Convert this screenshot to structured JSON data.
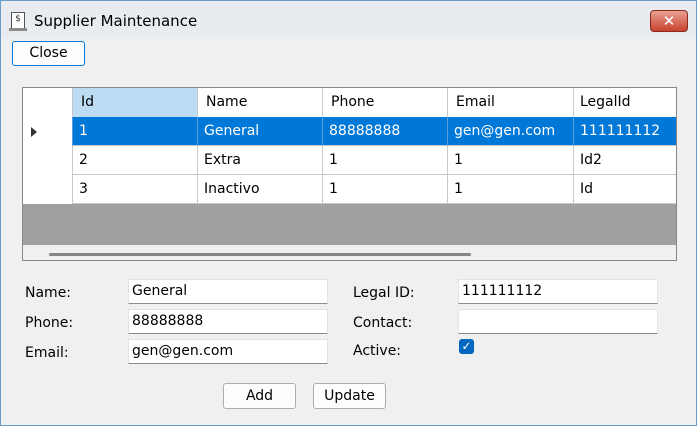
{
  "window": {
    "title": "Supplier Maintenance",
    "close_glyph": "✕"
  },
  "toolbar": {
    "close_label": "Close"
  },
  "grid": {
    "columns": [
      "Id",
      "Name",
      "Phone",
      "Email",
      "LegalId"
    ],
    "rows": [
      {
        "id": "1",
        "name": "General",
        "phone": "88888888",
        "email": "gen@gen.com",
        "legalid": "111111112",
        "selected": true
      },
      {
        "id": "2",
        "name": "Extra",
        "phone": "1",
        "email": "1",
        "legalid": "Id2",
        "selected": false
      },
      {
        "id": "3",
        "name": "Inactivo",
        "phone": "1",
        "email": "1",
        "legalid": "Id",
        "selected": false
      }
    ],
    "current_row_indicator": "row-1",
    "scroll_thumb_fraction": 0.66
  },
  "form": {
    "name_label": "Name:",
    "name_value": "General",
    "phone_label": "Phone:",
    "phone_value": "88888888",
    "email_label": "Email:",
    "email_value": "gen@gen.com",
    "legal_label": "Legal ID:",
    "legal_value": "111111112",
    "contact_label": "Contact:",
    "contact_value": "",
    "active_label": "Active:",
    "active_checked": true
  },
  "actions": {
    "add_label": "Add",
    "update_label": "Update"
  },
  "colors": {
    "selection": "#0078d7",
    "header_selected": "#bcdcf4",
    "grid_empty": "#a0a0a0",
    "close_button": "#c7432f"
  }
}
